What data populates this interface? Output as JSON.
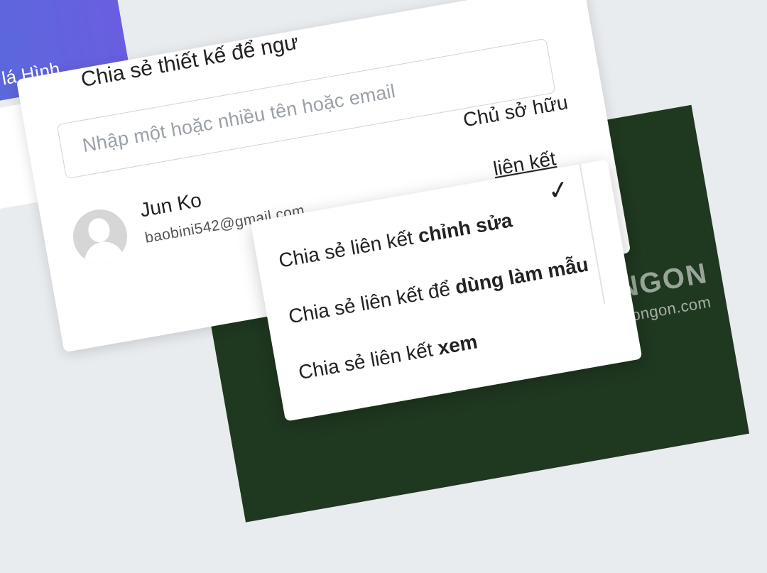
{
  "header": {
    "title_fragment": "anh lá Hình"
  },
  "share": {
    "title": "Chia sẻ thiết kế để ngư",
    "input_placeholder": "Nhập một hoặc nhiều tên hoặc email",
    "owner_label": "Chủ sở hữu",
    "link_label": "liên kết"
  },
  "user": {
    "name": "Jun Ko",
    "email": "baobini542@gmail.com"
  },
  "menu": {
    "items": [
      {
        "prefix": "Chia sẻ liên kết ",
        "bold": "chỉnh sửa",
        "selected": true
      },
      {
        "prefix": "Chia sẻ liên kết để ",
        "bold": "dùng làm mẫu",
        "selected": false
      },
      {
        "prefix": "Chia sẻ liên kết ",
        "bold": "xem",
        "selected": false
      }
    ],
    "check_icon": "✓"
  },
  "watermark": {
    "logo": "APPNGON",
    "url": "https://appngon.com"
  },
  "colors": {
    "header": "#5b66dd",
    "design_bg": "#1f3820",
    "leaf": "#7cc04b"
  }
}
